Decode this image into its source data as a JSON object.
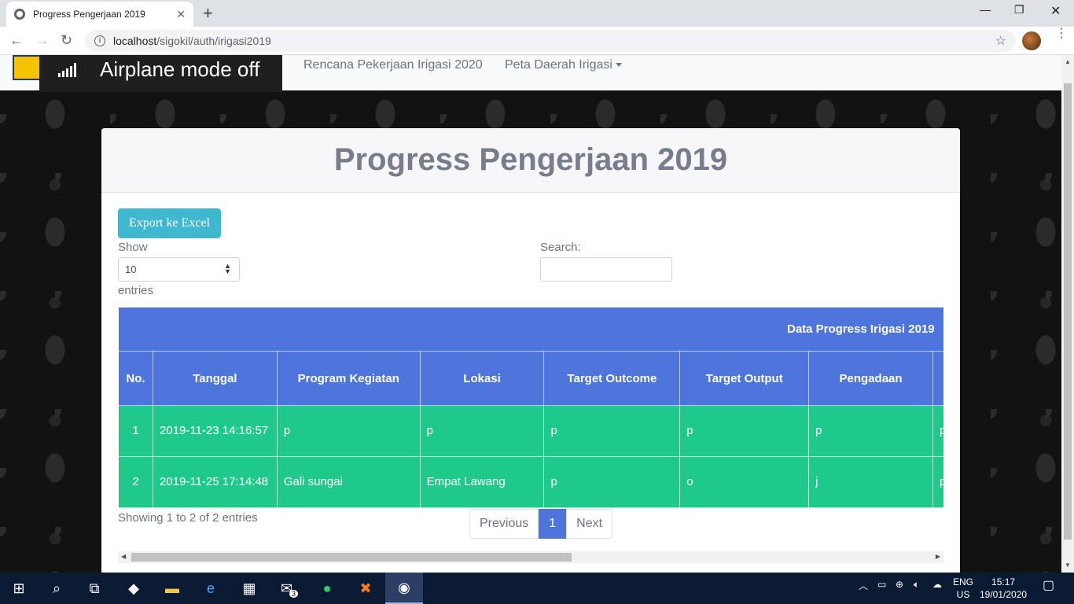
{
  "browser": {
    "tab_title": "Progress Pengerjaan 2019",
    "url_host": "localhost",
    "url_path": "/sigokil/auth/irigasi2019"
  },
  "site_nav": {
    "links": [
      "Rencana Pekerjaan Irigasi 2020",
      "Peta Daerah Irigasi"
    ]
  },
  "notification": {
    "text": "Airplane mode off"
  },
  "card": {
    "title": "Progress Pengerjaan 2019",
    "export_label": "Export ke Excel",
    "show_label": "Show",
    "entries_label": "entries",
    "page_size": "10",
    "search_label": "Search:",
    "search_value": ""
  },
  "table": {
    "caption": "Data Progress Irigasi 2019",
    "headers": [
      "No.",
      "Tanggal",
      "Program Kegiatan",
      "Lokasi",
      "Target Outcome",
      "Target Output",
      "Pengadaan",
      ""
    ],
    "rows": [
      [
        "1",
        "2019-11-23 14:16:57",
        "p",
        "p",
        "p",
        "p",
        "p",
        "p"
      ],
      [
        "2",
        "2019-11-25 17:14:48",
        "Gali sungai",
        "Empat Lawang",
        "p",
        "o",
        "j",
        "p"
      ]
    ],
    "info": "Showing 1 to 2 of 2 entries"
  },
  "pagination": {
    "previous": "Previous",
    "current": "1",
    "next": "Next"
  },
  "taskbar": {
    "mail_badge": "3",
    "lang_top": "ENG",
    "lang_bottom": "US",
    "time": "15:17",
    "date": "19/01/2020"
  },
  "colors": {
    "table_header": "#4d75db",
    "table_row": "#1fc98a",
    "export_button": "#3fb7cf",
    "taskbar": "#0b1a33"
  }
}
